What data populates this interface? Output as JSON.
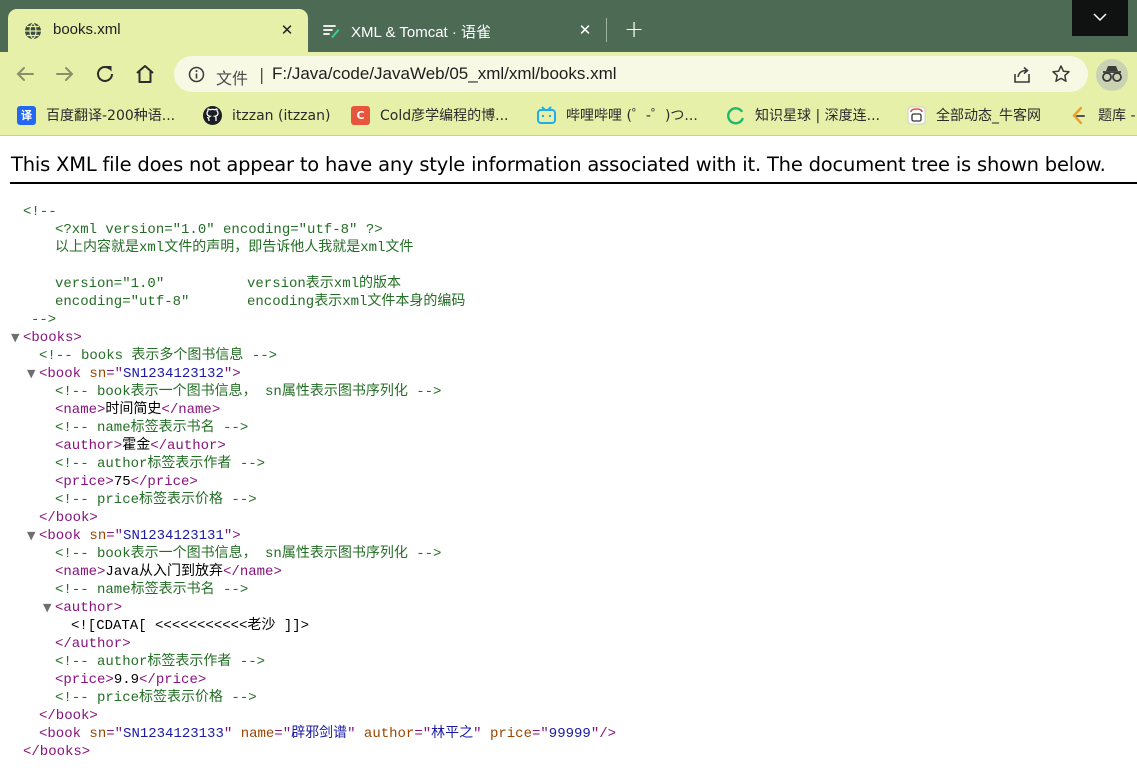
{
  "tabs": [
    {
      "title": "books.xml",
      "active": true,
      "icon": "globe-icon"
    },
    {
      "title": "XML & Tomcat · 语雀",
      "active": false,
      "icon": "yuque-icon"
    }
  ],
  "toolbar": {
    "scheme_label": "文件",
    "separator": "|",
    "url": "F:/Java/code/JavaWeb/05_xml/xml/books.xml"
  },
  "bookmarks": [
    {
      "label": "百度翻译-200种语...",
      "icon_text": "译",
      "color": "#2468f2"
    },
    {
      "label": "itzzan (itzzan)",
      "icon_text": "",
      "color": "#1b1f23"
    },
    {
      "label": "Cold彦学编程的博...",
      "icon_text": "C",
      "color": "#e8553d"
    },
    {
      "label": "哔哩哔哩 (゜-゜)つ...",
      "icon_text": "",
      "color": "#23ade5"
    },
    {
      "label": "知识星球 | 深度连...",
      "icon_text": "",
      "color": "#1bb96b"
    },
    {
      "label": "全部动态_牛客网",
      "icon_text": "",
      "color": "#e54d42"
    },
    {
      "label": "题库 -",
      "icon_text": "",
      "color": "#f0a020"
    }
  ],
  "notice": "This XML file does not appear to have any style information associated with it. The document tree is shown below.",
  "colors": {
    "tabstrip": "#4d6a55",
    "toolbar": "#e6f0a8",
    "comment": "#236e25",
    "tag": "#881280",
    "attribute": "#994500",
    "value": "#1a1aa6"
  },
  "xml": {
    "c1_open": "<!--",
    "c1_l1": "<?xml version=\"1.0\" encoding=\"utf-8\" ?>",
    "c1_l2": "以上内容就是xml文件的声明，即告诉他人我就是xml文件",
    "c1_l3a": "version=\"1.0\"",
    "c1_l3b": "version表示xml的版本",
    "c1_l4a": "encoding=\"utf-8\"",
    "c1_l4b": "encoding表示xml文件本身的编码",
    "c1_close": "-->",
    "books_open": "<books>",
    "books_comment": "<!-- books 表示多个图书信息 -->",
    "b1_open_a": "<book ",
    "b1_attr": "sn",
    "b1_eq": "=\"",
    "b1_val": "SN1234123132",
    "b1_end": "\">",
    "b_comment1": "<!-- book表示一个图书信息， sn属性表示图书序列化 -->",
    "b1_name_open": "<name>",
    "b1_name": "时间简史",
    "b1_name_close": "</name>",
    "b_comment2": "<!-- name标签表示书名 -->",
    "b1_author_open": "<author>",
    "b1_author": "霍金",
    "b1_author_close": "</author>",
    "b_comment3": "<!-- author标签表示作者 -->",
    "b1_price_open": "<price>",
    "b1_price": "75",
    "b1_price_close": "</price>",
    "b_comment4": "<!-- price标签表示价格 -->",
    "book_close": "</book>",
    "b2_val": "SN1234123131",
    "b2_name": "Java从入门到放弃",
    "b2_author_open": "<author>",
    "b2_cdata": "<![CDATA[ <<<<<<<<<<<老沙 ]]>",
    "b2_author_close": "</author>",
    "b2_price": "9.9",
    "b3_val": "SN1234123133",
    "b3_name_attr": "name",
    "b3_name_val": "辟邪剑谱",
    "b3_author_attr": "author",
    "b3_author_val": "林平之",
    "b3_price_attr": "price",
    "b3_price_val": "99999",
    "b3_end": "\"/>",
    "books_close": "</books>"
  }
}
